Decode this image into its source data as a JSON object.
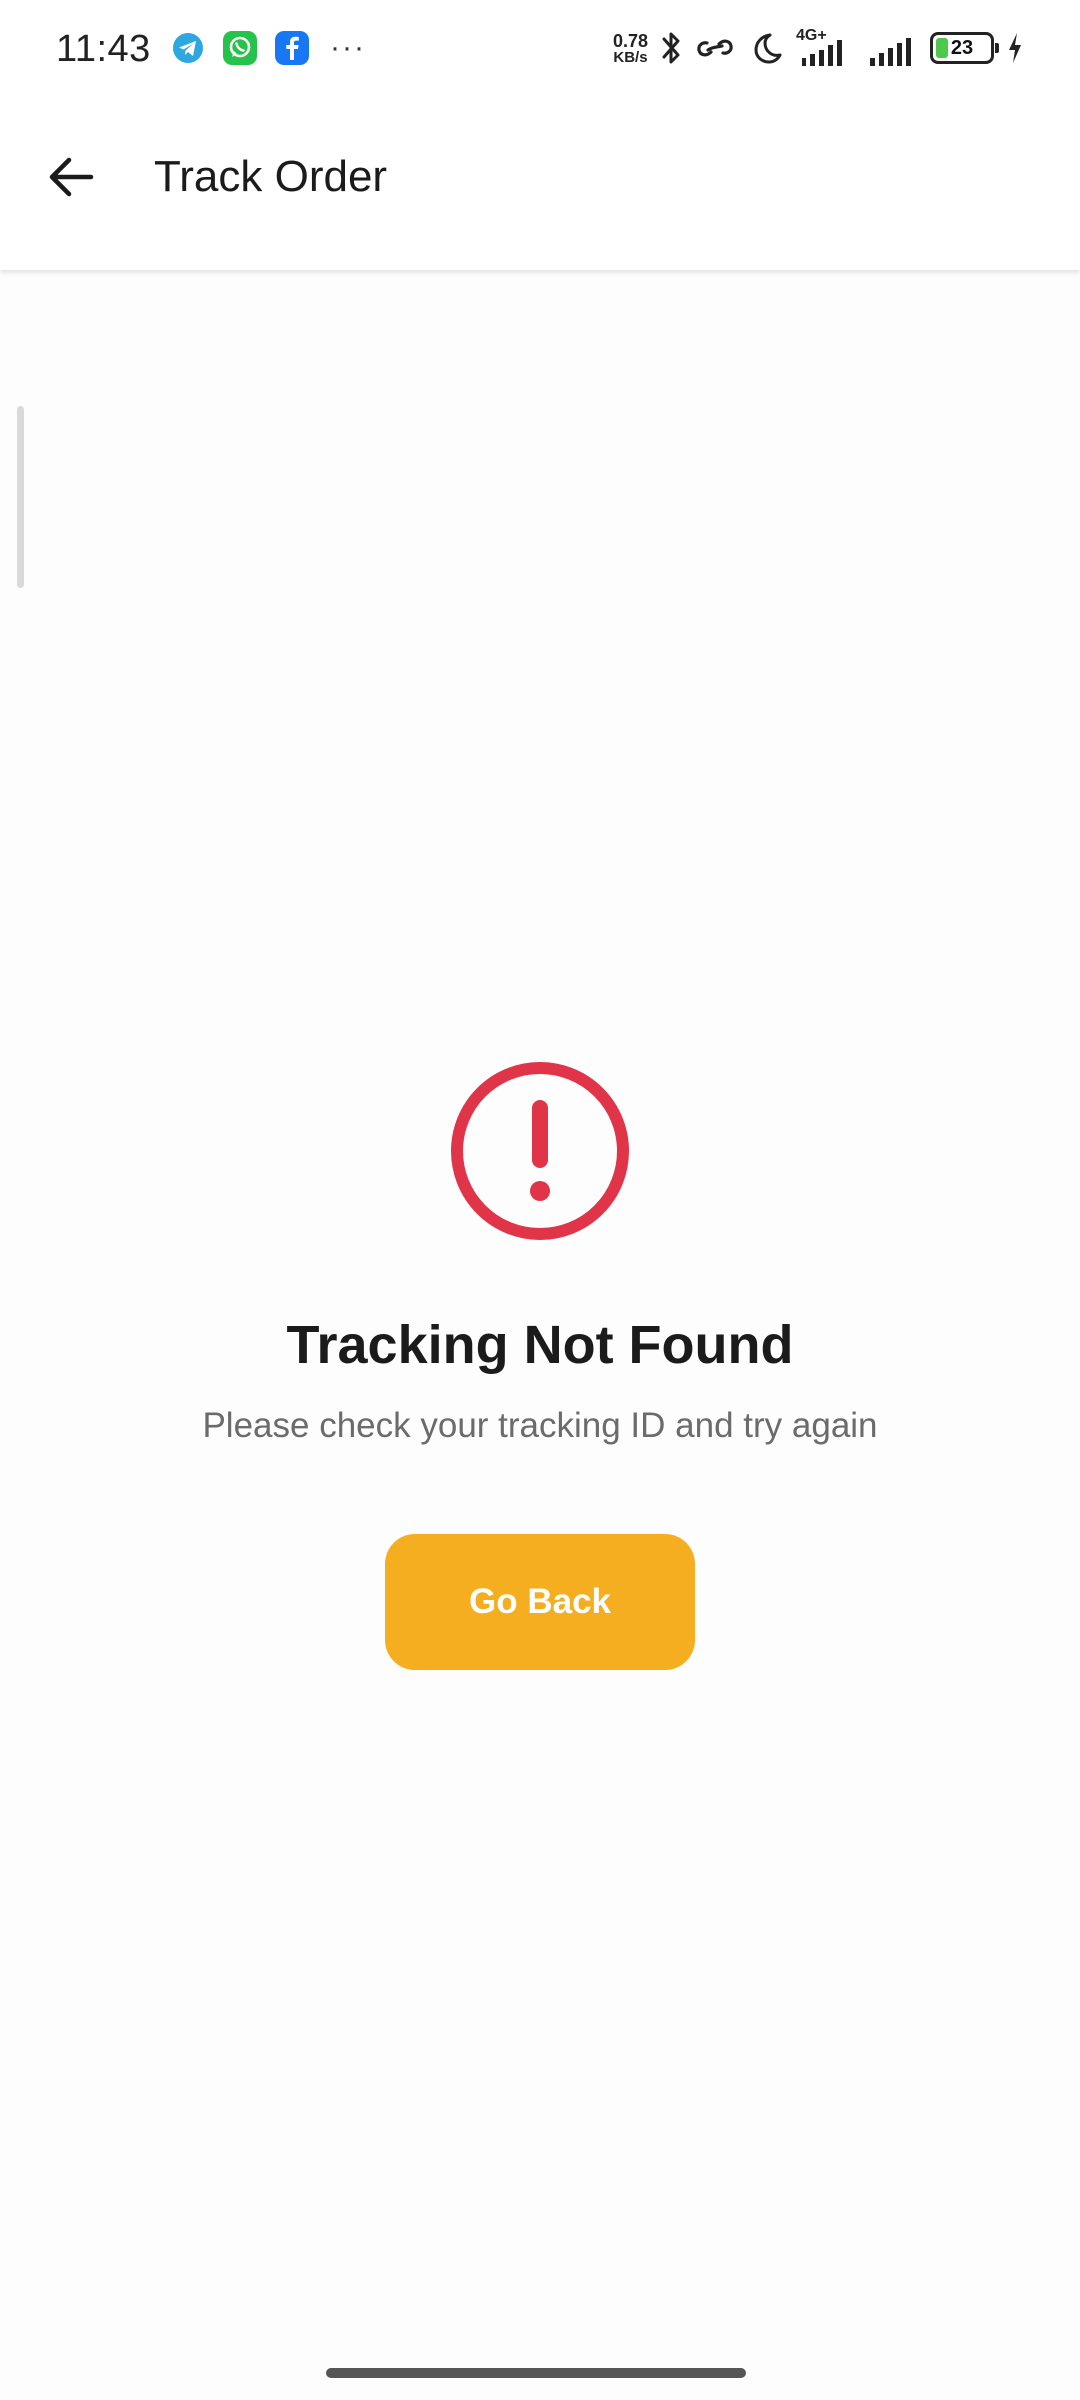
{
  "status_bar": {
    "time": "11:43",
    "notification_icons": [
      "telegram-icon",
      "whatsapp-icon",
      "facebook-icon"
    ],
    "more": "···",
    "net_speed_value": "0.78",
    "net_speed_unit": "KB/s",
    "network_type": "4G+",
    "battery_level": "23",
    "battery_color": "#4cc84a"
  },
  "app_bar": {
    "title": "Track Order",
    "back_icon": "arrow-left-icon"
  },
  "error": {
    "icon": "alert-circle-icon",
    "icon_color": "#e03448",
    "title": "Tracking Not Found",
    "message": "Please check your tracking ID and try again",
    "button_label": "Go Back",
    "button_color": "#f5ae20"
  }
}
